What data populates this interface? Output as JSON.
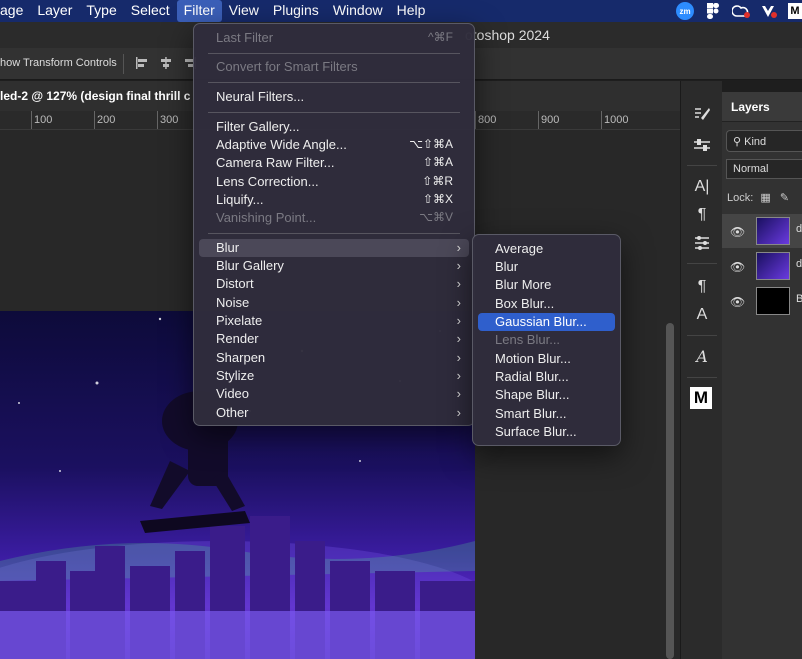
{
  "menubar": {
    "items": [
      "age",
      "Layer",
      "Type",
      "Select",
      "Filter",
      "View",
      "Plugins",
      "Window",
      "Help"
    ],
    "active_index": 4,
    "tray": [
      "zoom-icon",
      "figma-icon",
      "creative-cloud-icon",
      "antivirus-icon",
      "m-icon"
    ]
  },
  "title": "otoshop 2024",
  "optbar": {
    "show_transform_label": "how Transform Controls"
  },
  "doc_tab": "led-2 @ 127% (design final thrill c",
  "ruler_ticks": [
    "100",
    "200",
    "300",
    "800",
    "900",
    "1000"
  ],
  "layers_panel": {
    "tab": "Layers",
    "kind": "Kind",
    "blend": "Normal",
    "lock": "Lock:",
    "layers": [
      {
        "name": "d"
      },
      {
        "name": "d"
      },
      {
        "name": "B"
      }
    ]
  },
  "filter_menu": {
    "items": [
      {
        "label": "Last Filter",
        "shortcut": "^⌘F",
        "disabled": true
      },
      {
        "label": "Convert for Smart Filters",
        "shortcut": "",
        "disabled": true
      },
      {
        "label": "Neural Filters...",
        "shortcut": "",
        "disabled": false
      },
      {
        "label": "Filter Gallery...",
        "shortcut": "",
        "disabled": false
      },
      {
        "label": "Adaptive Wide Angle...",
        "shortcut": "⌥⇧⌘A",
        "disabled": false
      },
      {
        "label": "Camera Raw Filter...",
        "shortcut": "⇧⌘A",
        "disabled": false
      },
      {
        "label": "Lens Correction...",
        "shortcut": "⇧⌘R",
        "disabled": false
      },
      {
        "label": "Liquify...",
        "shortcut": "⇧⌘X",
        "disabled": false
      },
      {
        "label": "Vanishing Point...",
        "shortcut": "⌥⌘V",
        "disabled": true
      },
      {
        "label": "Blur",
        "submenu": true
      },
      {
        "label": "Blur Gallery",
        "submenu": true
      },
      {
        "label": "Distort",
        "submenu": true
      },
      {
        "label": "Noise",
        "submenu": true
      },
      {
        "label": "Pixelate",
        "submenu": true
      },
      {
        "label": "Render",
        "submenu": true
      },
      {
        "label": "Sharpen",
        "submenu": true
      },
      {
        "label": "Stylize",
        "submenu": true
      },
      {
        "label": "Video",
        "submenu": true
      },
      {
        "label": "Other",
        "submenu": true
      }
    ]
  },
  "blur_menu": {
    "items": [
      {
        "label": "Average",
        "disabled": false
      },
      {
        "label": "Blur",
        "disabled": false
      },
      {
        "label": "Blur More",
        "disabled": false
      },
      {
        "label": "Box Blur...",
        "disabled": false
      },
      {
        "label": "Gaussian Blur...",
        "disabled": false,
        "selected": true
      },
      {
        "label": "Lens Blur...",
        "disabled": true
      },
      {
        "label": "Motion Blur...",
        "disabled": false
      },
      {
        "label": "Radial Blur...",
        "disabled": false
      },
      {
        "label": "Shape Blur...",
        "disabled": false
      },
      {
        "label": "Smart Blur...",
        "disabled": false
      },
      {
        "label": "Surface Blur...",
        "disabled": false
      }
    ]
  },
  "colors": {
    "accent": "#2f5fcc",
    "menubar": "#162a6b",
    "artwork_purple": "#5b2ac8"
  }
}
